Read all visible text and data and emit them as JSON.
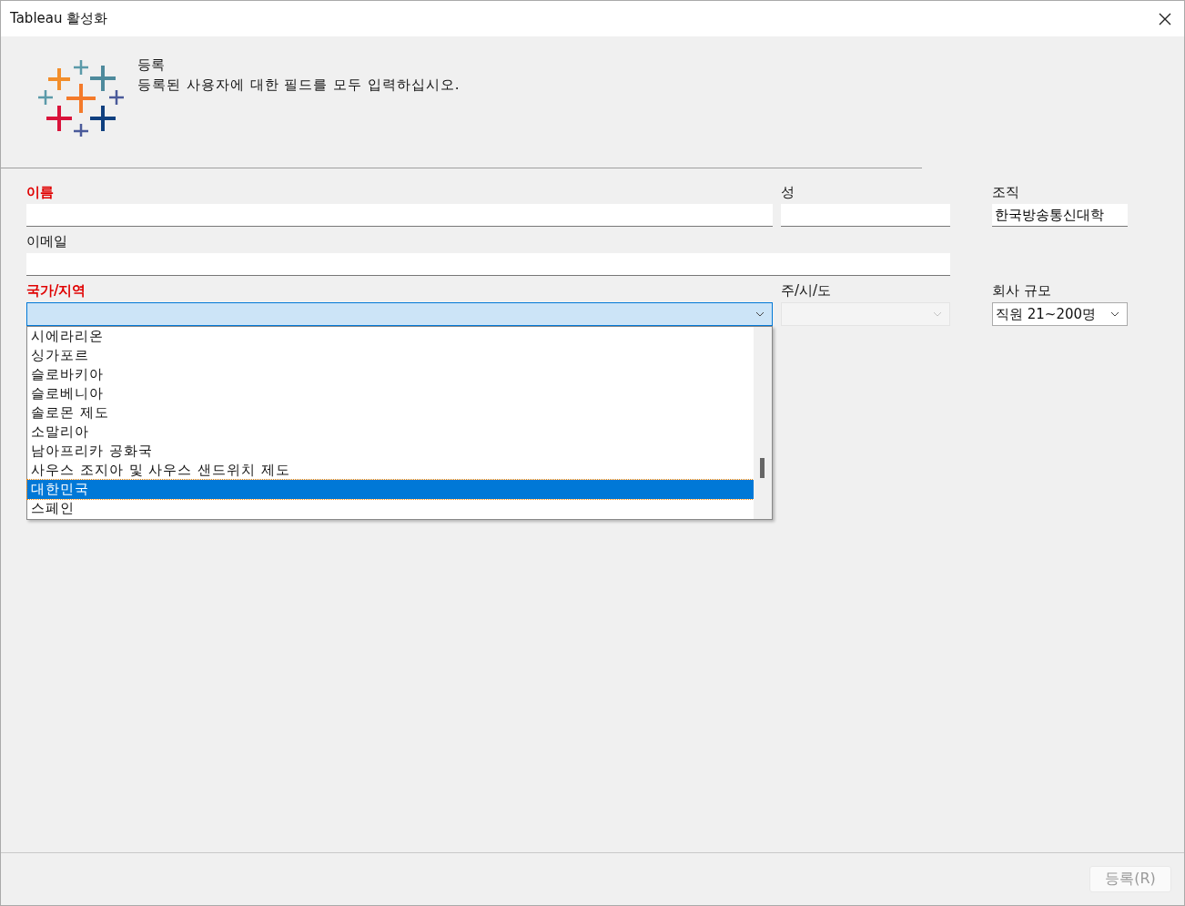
{
  "window": {
    "title": "Tableau 활성화"
  },
  "header": {
    "title": "등록",
    "description": "등록된 사용자에 대한 필드를 모두 입력하십시오."
  },
  "rows": [
    {
      "fields": [
        {
          "kind": "text",
          "label": "이름",
          "required": true
        },
        {
          "kind": "text",
          "label": "성",
          "required": false
        },
        {
          "kind": "text",
          "label": "조직",
          "required": false,
          "value": "한국방송통신대학"
        }
      ]
    },
    {
      "fields": [
        {
          "kind": "text",
          "label": "이메일",
          "required": false
        }
      ]
    },
    {
      "fields": [
        {
          "kind": "select",
          "label": "국가/지역",
          "required": true,
          "expanded": true,
          "disabled": false,
          "options": [
            {
              "label": "시에라리온",
              "selected": false
            },
            {
              "label": "싱가포르",
              "selected": false
            },
            {
              "label": "슬로바키아",
              "selected": false
            },
            {
              "label": "슬로베니아",
              "selected": false
            },
            {
              "label": "솔로몬 제도",
              "selected": false
            },
            {
              "label": "소말리아",
              "selected": false
            },
            {
              "label": "남아프리카 공화국",
              "selected": false
            },
            {
              "label": "사우스 조지아 및 사우스 샌드위치 제도",
              "selected": false
            },
            {
              "label": "대한민국",
              "selected": true
            },
            {
              "label": "스페인",
              "selected": false
            }
          ]
        },
        {
          "kind": "select",
          "label": "주/시/도",
          "required": false,
          "expanded": false,
          "disabled": true
        },
        {
          "kind": "select",
          "label": "회사 규모",
          "required": false,
          "expanded": false,
          "disabled": false,
          "value": "직원 21~200명"
        }
      ]
    }
  ],
  "footer": {
    "button": {
      "label": "등록(R)",
      "disabled": true
    }
  }
}
